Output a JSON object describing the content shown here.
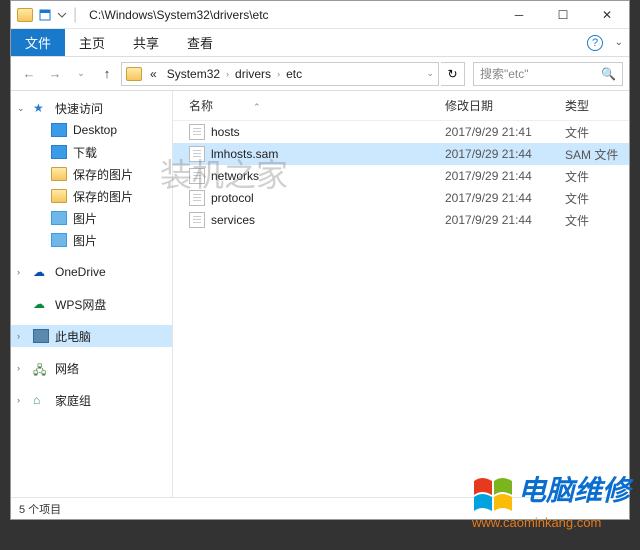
{
  "titlebar": {
    "path": "C:\\Windows\\System32\\drivers\\etc"
  },
  "ribbon": {
    "tabs": [
      "文件",
      "主页",
      "共享",
      "查看"
    ]
  },
  "breadcrumb": {
    "segments": [
      "System32",
      "drivers",
      "etc"
    ]
  },
  "search": {
    "placeholder": "搜索\"etc\""
  },
  "columns": {
    "name": "名称",
    "date": "修改日期",
    "type": "类型"
  },
  "sidebar": {
    "quickAccess": "快速访问",
    "items": [
      {
        "label": "Desktop"
      },
      {
        "label": "下载"
      },
      {
        "label": "保存的图片"
      },
      {
        "label": "保存的图片"
      },
      {
        "label": "图片"
      },
      {
        "label": "图片"
      }
    ],
    "onedrive": "OneDrive",
    "wps": "WPS网盘",
    "thispc": "此电脑",
    "network": "网络",
    "homegroup": "家庭组"
  },
  "files": [
    {
      "name": "hosts",
      "date": "2017/9/29 21:41",
      "type": "文件"
    },
    {
      "name": "lmhosts.sam",
      "date": "2017/9/29 21:44",
      "type": "SAM 文件"
    },
    {
      "name": "networks",
      "date": "2017/9/29 21:44",
      "type": "文件"
    },
    {
      "name": "protocol",
      "date": "2017/9/29 21:44",
      "type": "文件"
    },
    {
      "name": "services",
      "date": "2017/9/29 21:44",
      "type": "文件"
    }
  ],
  "statusbar": {
    "text": "5 个项目"
  },
  "watermark": "装机之家",
  "overlay": {
    "title": "电脑维修",
    "url": "www.caominkang.com"
  }
}
